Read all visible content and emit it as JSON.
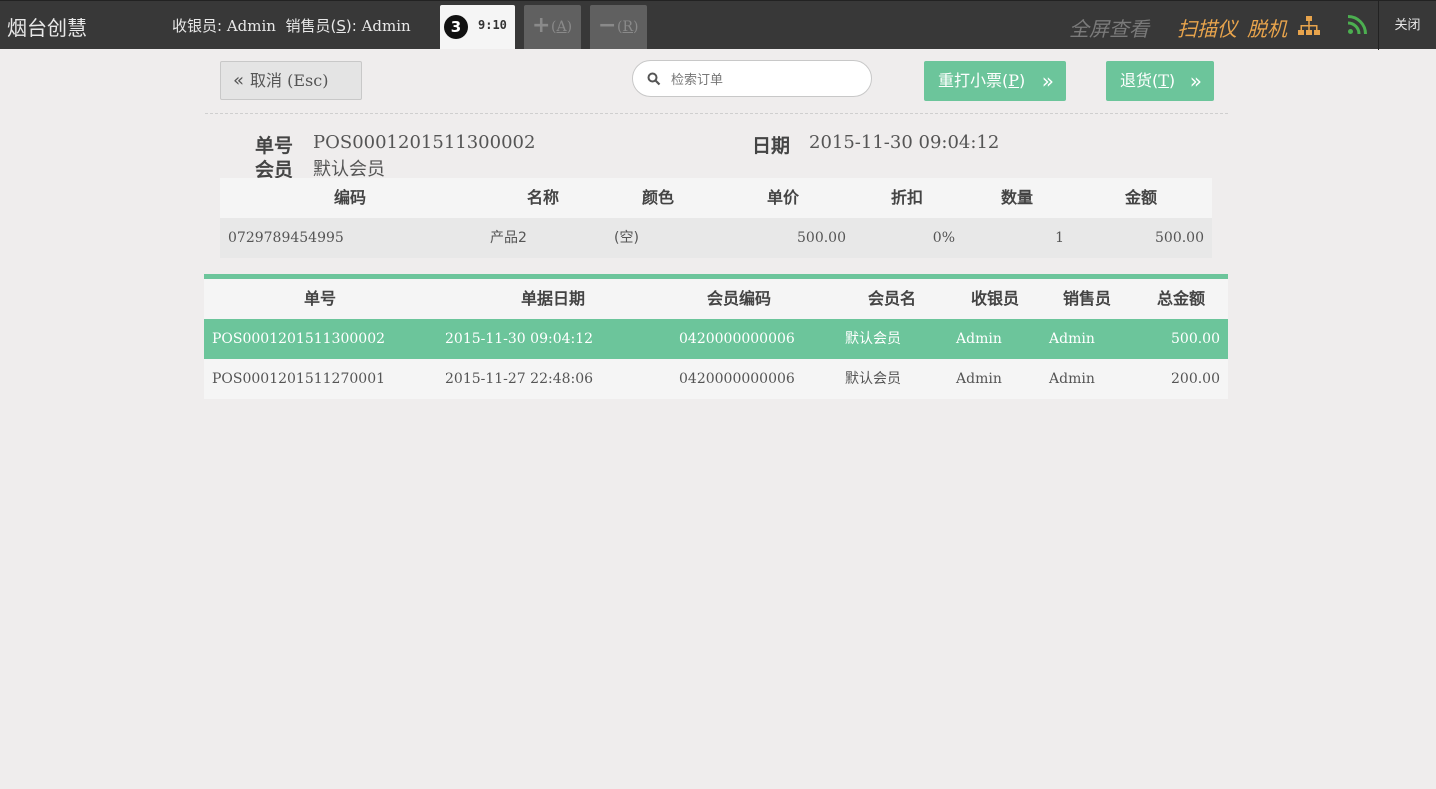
{
  "topbar": {
    "brand": "烟台创慧",
    "cashier_label": "收银员:",
    "cashier_name": "Admin",
    "seller_label_pre": "销售员(",
    "seller_hotkey": "S",
    "seller_label_post": "):",
    "seller_name": "Admin",
    "order_tab": {
      "badge": "3",
      "time": "9:10"
    },
    "add_tab": {
      "symbol": "+",
      "key_pre": "(",
      "key": "A",
      "key_post": ")"
    },
    "remove_tab": {
      "symbol": "−",
      "key_pre": "(",
      "key": "R",
      "key_post": ")"
    },
    "fullscreen": "全屏查看",
    "scanner": "扫描仪",
    "offline": "脱机",
    "close": "关闭",
    "colors": {
      "bar": "#383838",
      "accent": "#e8a44c",
      "rss": "#4caf50"
    }
  },
  "toolbar": {
    "cancel": {
      "chevron": "«",
      "text": "取消",
      "key": "(Esc)"
    },
    "search_placeholder": "检索订单",
    "reprint": {
      "text_pre": "重打小票(",
      "key": "P",
      "text_post": ")",
      "arrow": "»"
    },
    "refund": {
      "text_pre": "退货(",
      "key": "T",
      "text_post": ")",
      "arrow": "»"
    },
    "colors": {
      "primary": "#6cc59b"
    }
  },
  "order_info": {
    "number_label": "单号",
    "number": "POS0001201511300002",
    "date_label": "日期",
    "date": "2015-11-30 09:04:12",
    "member_label": "会员",
    "member": "默认会员"
  },
  "items_table": {
    "headers": [
      "编码",
      "名称",
      "颜色",
      "单价",
      "折扣",
      "数量",
      "金额"
    ],
    "rows": [
      [
        "0729789454995",
        "产品2",
        "(空)",
        "500.00",
        "0%",
        "1",
        "500.00"
      ]
    ]
  },
  "orders_table": {
    "headers": [
      "单号",
      "单据日期",
      "会员编码",
      "会员名",
      "收银员",
      "销售员",
      "总金额"
    ],
    "rows": [
      [
        "POS0001201511300002",
        "2015-11-30 09:04:12",
        "0420000000006",
        "默认会员",
        "Admin",
        "Admin",
        "500.00"
      ],
      [
        "POS0001201511270001",
        "2015-11-27 22:48:06",
        "0420000000006",
        "默认会员",
        "Admin",
        "Admin",
        "200.00"
      ]
    ],
    "selected_row": 0
  }
}
